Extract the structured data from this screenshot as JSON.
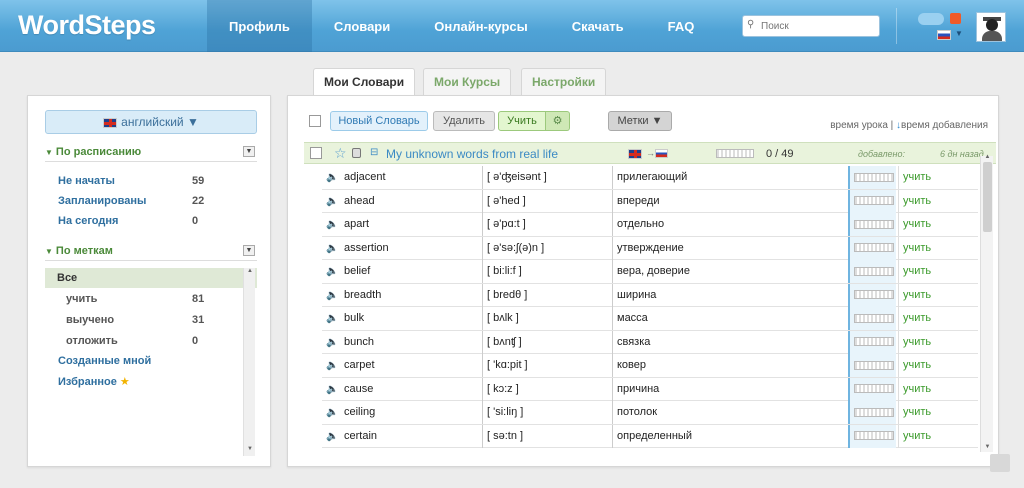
{
  "app": {
    "logo": "WordSteps"
  },
  "nav": {
    "items": [
      "Профиль",
      "Словари",
      "Онлайн-курсы",
      "Скачать",
      "FAQ"
    ],
    "active_index": 0
  },
  "search": {
    "placeholder": "Поиск"
  },
  "left": {
    "language_button": "английский ▼",
    "schedule_title": "По расписанию",
    "schedule_items": [
      {
        "label": "Не начаты",
        "count": "59"
      },
      {
        "label": "Запланированы",
        "count": "22"
      },
      {
        "label": "На сегодня",
        "count": "0"
      }
    ],
    "tags_title": "По меткам",
    "all_label": "Все",
    "tag_items": [
      {
        "label": "учить",
        "count": "81"
      },
      {
        "label": "выучено",
        "count": "31"
      },
      {
        "label": "отложить",
        "count": "0"
      }
    ],
    "created_by_me": "Созданные мной",
    "favorites": "Избранное"
  },
  "tabs": [
    "Мои Словари",
    "Мои Курсы",
    "Настройки"
  ],
  "toolbar": {
    "new_dict": "Новый Словарь",
    "delete": "Удалить",
    "learn": "Учить",
    "tags": "Метки ▼",
    "sort_lesson_time": "время урока |",
    "sort_added_time": "время добавления"
  },
  "dictionary": {
    "title": "My unknown words from real life",
    "progress": "0 / 49",
    "progress_fraction": 0,
    "added_label": "добавлено:",
    "added_ago": "6 дн назад"
  },
  "words": [
    {
      "word": "adjacent",
      "transcription": "[ ə'ʤeisənt ]",
      "translation": "прилегающий",
      "action": "учить"
    },
    {
      "word": "ahead",
      "transcription": "[ ə'hed ]",
      "translation": "впереди",
      "action": "учить"
    },
    {
      "word": "apart",
      "transcription": "[ ə'pɑ:t ]",
      "translation": "отдельно",
      "action": "учить"
    },
    {
      "word": "assertion",
      "transcription": "[ ə'sə:ʃ(ə)n ]",
      "translation": "утверждение",
      "action": "учить"
    },
    {
      "word": "belief",
      "transcription": "[ bi:li:f ]",
      "translation": "вера, доверие",
      "action": "учить"
    },
    {
      "word": "breadth",
      "transcription": "[ bredθ ]",
      "translation": "ширина",
      "action": "учить"
    },
    {
      "word": "bulk",
      "transcription": "[ bʌlk ]",
      "translation": "масса",
      "action": "учить"
    },
    {
      "word": "bunch",
      "transcription": "[ bʌnʧ ]",
      "translation": "связка",
      "action": "учить"
    },
    {
      "word": "carpet",
      "transcription": "[ 'kɑ:pit ]",
      "translation": "ковер",
      "action": "учить"
    },
    {
      "word": "cause",
      "transcription": "[ kɔ:z ]",
      "translation": "причина",
      "action": "учить"
    },
    {
      "word": "ceiling",
      "transcription": "[ 'si:liŋ ]",
      "translation": "потолок",
      "action": "учить"
    },
    {
      "word": "certain",
      "transcription": "[ sə:tn ]",
      "translation": "определенный",
      "action": "учить"
    }
  ]
}
